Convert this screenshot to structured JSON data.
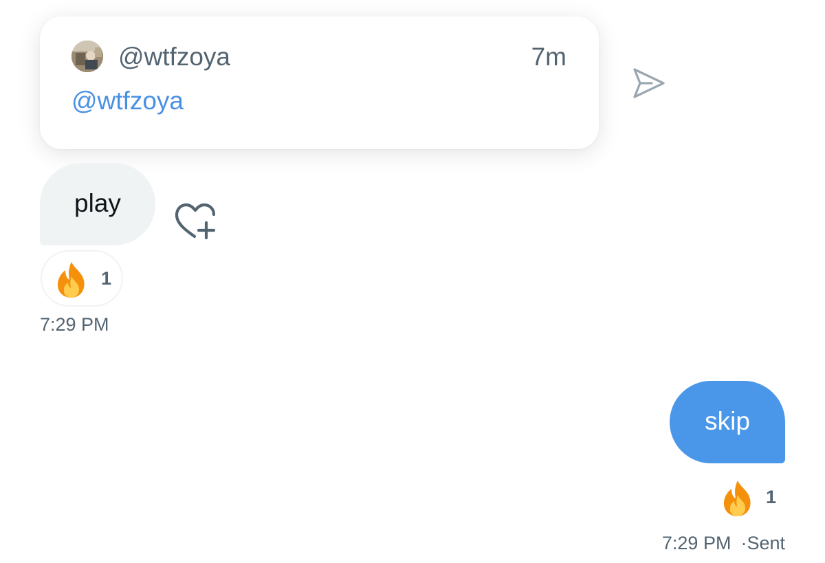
{
  "quoted_tweet": {
    "handle": "@wtfzoya",
    "age": "7m",
    "text": "@wtfzoya",
    "avatar_icon": "user-avatar"
  },
  "share": {
    "icon": "send-icon"
  },
  "messages": {
    "received": {
      "text": "play",
      "reaction": {
        "emoji": "🔥",
        "icon": "fire-icon",
        "count": "1"
      },
      "time": "7:29 PM",
      "add_reaction_icon": "heart-plus-icon"
    },
    "sent": {
      "text": "skip",
      "reaction": {
        "emoji": "🔥",
        "icon": "fire-icon",
        "count": "1"
      },
      "time": "7:29 PM",
      "separator": "·",
      "status": "Sent"
    }
  },
  "colors": {
    "link": "#4a90e2",
    "sent_bubble": "#4a96e8",
    "received_bubble": "#eff3f4",
    "secondary_text": "#536471"
  }
}
